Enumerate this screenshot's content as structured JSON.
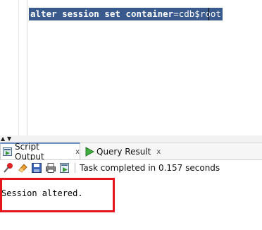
{
  "editor": {
    "keyword_text": "alter session set container",
    "value_text": "=cdb$root"
  },
  "tabs": [
    {
      "label": "Script Output",
      "close": "x",
      "icon": "script-output-icon",
      "active": true
    },
    {
      "label": "Query Result",
      "close": "x",
      "icon": "play-icon",
      "active": false
    }
  ],
  "toolbar": {
    "icons": [
      "pin-icon",
      "eraser-icon",
      "save-icon",
      "print-icon",
      "export-icon"
    ],
    "status": "Task completed in 0.157 seconds"
  },
  "output": {
    "message": "Session altered."
  },
  "colors": {
    "selection": "#3a5a8e",
    "highlight_box": "#e8141c",
    "active_tab_border": "#6d8fc3"
  }
}
